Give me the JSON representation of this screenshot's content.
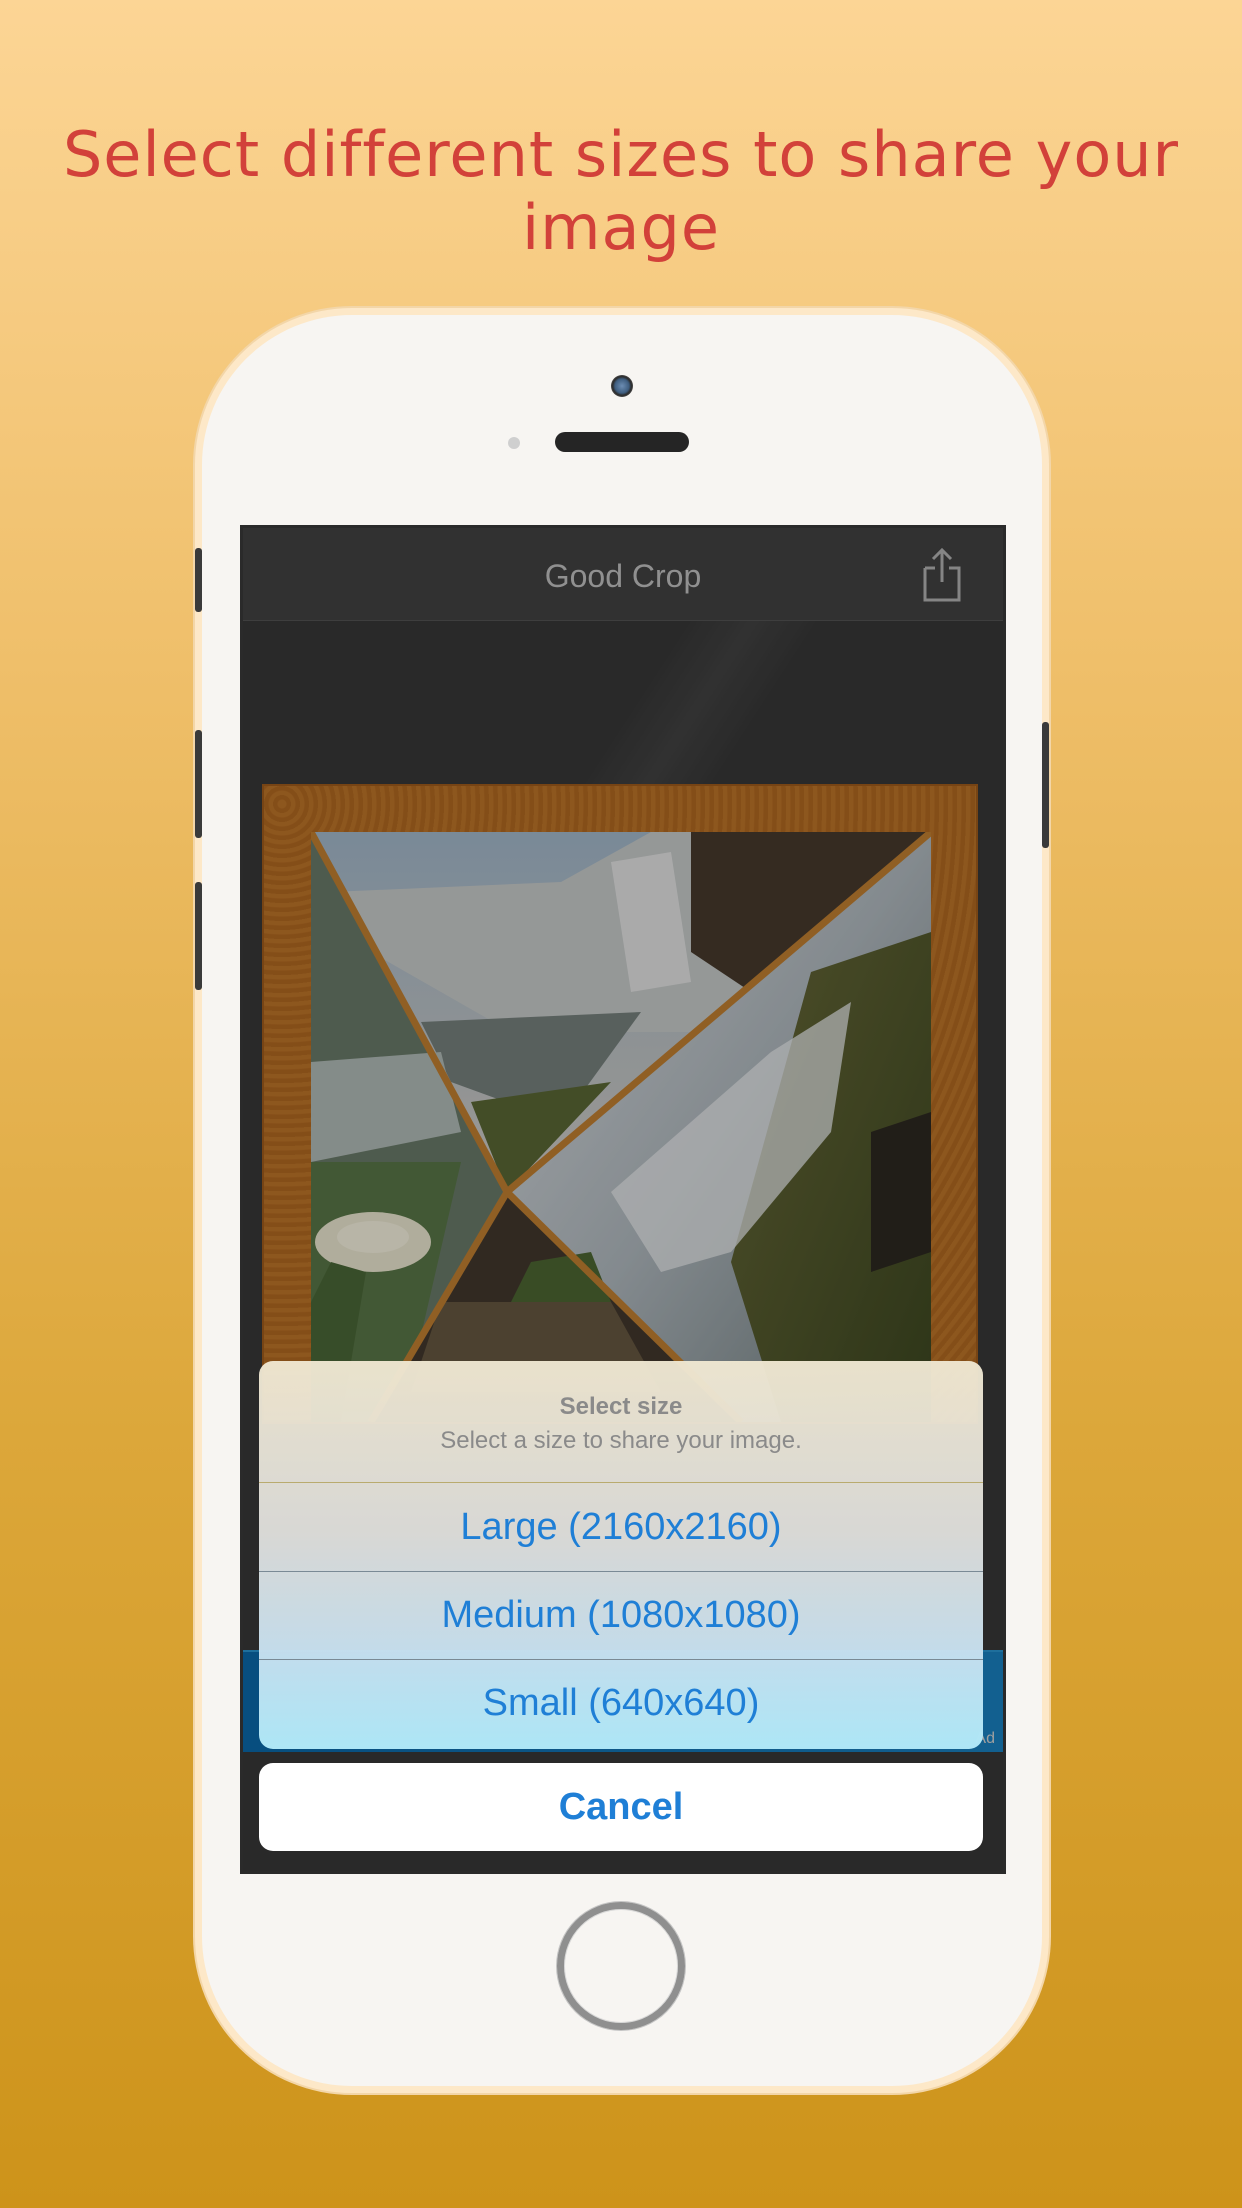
{
  "headline": "Select different sizes to share your image",
  "app": {
    "title": "Good Crop",
    "share_icon": "share-icon"
  },
  "collage": {
    "description_icon": "photo-collage"
  },
  "ad": {
    "marker": "Ad"
  },
  "action_sheet": {
    "title": "Select size",
    "message": "Select a size to share your image.",
    "options": [
      {
        "label": "Large (2160x2160)"
      },
      {
        "label": "Medium (1080x1080)"
      },
      {
        "label": "Small (640x640)"
      }
    ],
    "cancel_label": "Cancel"
  },
  "colors": {
    "headline": "#d2413a",
    "accent_blue": "#1f7fd6",
    "frame_orange": "#c27a2c"
  }
}
